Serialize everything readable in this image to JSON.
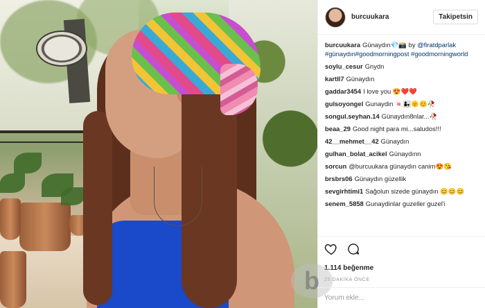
{
  "post": {
    "username": "burcuukara",
    "follow_label": "Takipetsin",
    "caption": {
      "user": "burcuukara",
      "text": "Günaydın💎📸 by",
      "mention": "@firatdparlak",
      "hashtags": "#günaydın#goodmorningpost #goodmorningworld"
    },
    "comments": [
      {
        "user": "soylu_cesur",
        "text": "Gnydn"
      },
      {
        "user": "kartll7",
        "text": "Günaydın"
      },
      {
        "user": "gaddar3454",
        "text": "I love you 😍❤️❤️"
      },
      {
        "user": "gulsoyongel",
        "text": "Gunaydin 🍬👩‍👧🌞😊🥀"
      },
      {
        "user": "songul.seyhan.14",
        "text": "Günaydın8nlar...🥀"
      },
      {
        "user": "beaa_29",
        "text": "Good night para mi...saludos!!!"
      },
      {
        "user": "42__mehmet__42",
        "text": "Günaydın"
      },
      {
        "user": "gulhan_bolat_acikel",
        "text": "Günaydınn"
      },
      {
        "user": "sorcun",
        "text": "@burcuukara günaydın canim😍😘"
      },
      {
        "user": "brsbrs06",
        "text": "Günaydın güzellik"
      },
      {
        "user": "sevgirhtimi1",
        "text": "Sağolun sizede günaydın 😊😊😊"
      },
      {
        "user": "senem_5858",
        "text": "Gunaydinlar guzeller guzel'i"
      }
    ],
    "likes": "1.114 beğenme",
    "time": "25 DAKİKA ÖNCE",
    "add_comment_placeholder": "Yorum ekle...",
    "watermark": "b"
  }
}
